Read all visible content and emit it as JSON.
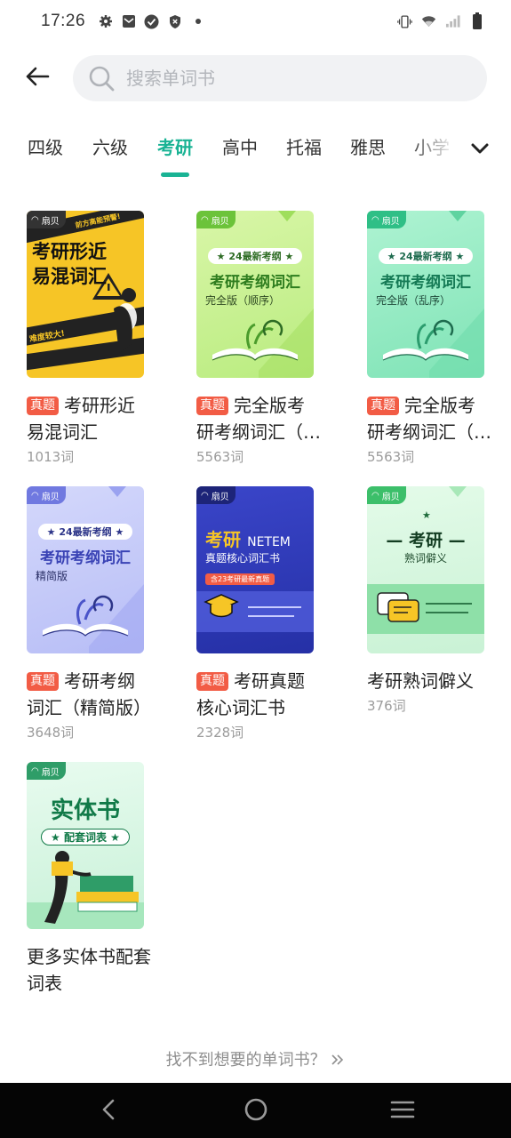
{
  "status_bar": {
    "time": "17:26",
    "left_icons": [
      "gear-icon",
      "mail-icon",
      "check-circle-icon",
      "shield-icon",
      "dot-icon"
    ],
    "right_icons": [
      "vibrate-icon",
      "wifi-icon",
      "signal-icon",
      "battery-icon"
    ]
  },
  "search": {
    "placeholder": "搜索单词书",
    "value": ""
  },
  "tabs": {
    "items": [
      "四级",
      "六级",
      "考研",
      "高中",
      "托福",
      "雅思",
      "小学"
    ],
    "active": "考研"
  },
  "books": [
    {
      "tag": "真题",
      "title": "考研形近易混词汇",
      "count": "1013词",
      "cover": {
        "brand": "扇贝",
        "lines": [
          "考研形近",
          "易混词汇"
        ],
        "strip_text": "难度较大!",
        "strip_text_2": "前方高能预警!"
      }
    },
    {
      "tag": "真题",
      "title": "完全版考研考纲词汇（顺序）",
      "count": "5563词",
      "cover": {
        "brand": "扇贝",
        "badge": "24最新考纲",
        "line1": "考研考纲词汇",
        "line2": "完全版（顺序）"
      }
    },
    {
      "tag": "真题",
      "title": "完全版考研考纲词汇（乱序）",
      "count": "5563词",
      "cover": {
        "brand": "扇贝",
        "badge": "24最新考纲",
        "line1": "考研考纲词汇",
        "line2": "完全版（乱序）"
      }
    },
    {
      "tag": "真题",
      "title": "考研考纲词汇（精简版）",
      "count": "3648词",
      "cover": {
        "brand": "扇贝",
        "badge": "24最新考纲",
        "line1": "考研考纲词汇",
        "line2": "精简版"
      }
    },
    {
      "tag": "真题",
      "title": "考研真题核心词汇书",
      "count": "2328词",
      "cover": {
        "brand": "扇贝",
        "line1": "考研",
        "line1b": "NETEM",
        "line2": "真题核心词汇书",
        "ribbon": "含23考研最新真题"
      }
    },
    {
      "tag": "",
      "title": "考研熟词僻义",
      "count": "376词",
      "cover": {
        "brand": "扇贝",
        "line1": "— 考研 —",
        "line2": "熟词僻义"
      }
    },
    {
      "tag": "",
      "title": "更多实体书配套词表",
      "count": "",
      "cover": {
        "brand": "扇贝",
        "line1": "实体书",
        "line2": "配套词表"
      }
    }
  ],
  "more_prompt": "找不到想要的单词书？",
  "nav": [
    "back-icon",
    "home-icon",
    "menu-icon"
  ],
  "colors": {
    "accent": "#19b394",
    "tag_red": "#f25c45",
    "count_gray": "#9b9b9b",
    "search_bg": "#f1f2f4"
  }
}
